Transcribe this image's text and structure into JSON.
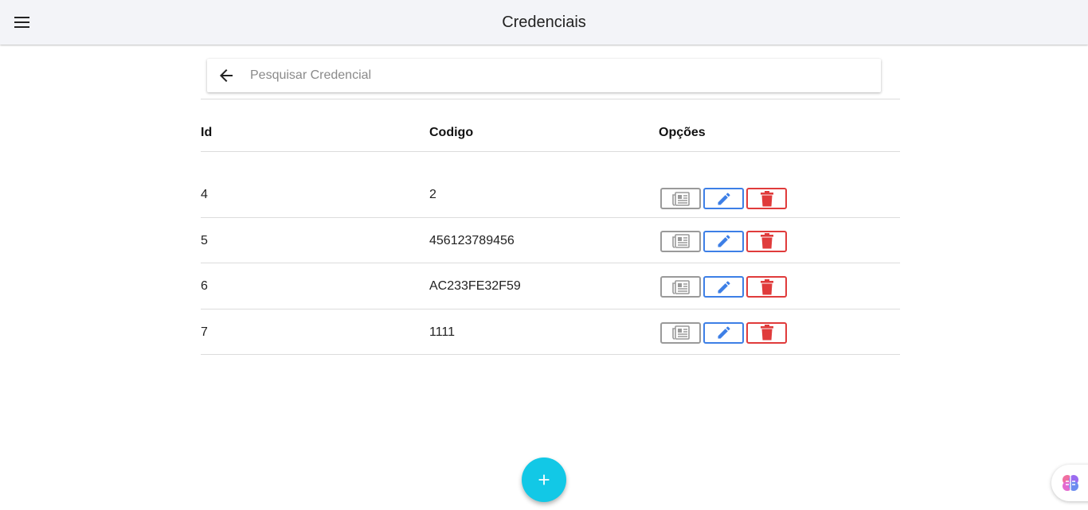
{
  "header": {
    "title": "Credenciais",
    "menu_icon": "menu-icon"
  },
  "search": {
    "placeholder": "Pesquisar Credencial",
    "value": "",
    "back_icon": "arrow-left-icon"
  },
  "table": {
    "columns": [
      "Id",
      "Codigo",
      "Opções"
    ],
    "rows": [
      {
        "id": "4",
        "codigo": "2"
      },
      {
        "id": "5",
        "codigo": "456123789456"
      },
      {
        "id": "6",
        "codigo": "AC233FE32F59"
      },
      {
        "id": "7",
        "codigo": "1111"
      }
    ],
    "actions": [
      {
        "name": "view",
        "icon": "newspaper-icon",
        "color": "#9a9a9a"
      },
      {
        "name": "edit",
        "icon": "pencil-icon",
        "color": "#3d7fe6"
      },
      {
        "name": "delete",
        "icon": "trash-icon",
        "color": "#e03b3b"
      }
    ]
  },
  "fab": {
    "icon": "plus-icon",
    "color": "#12c8e6"
  },
  "assistant": {
    "icon": "brain-icon"
  }
}
